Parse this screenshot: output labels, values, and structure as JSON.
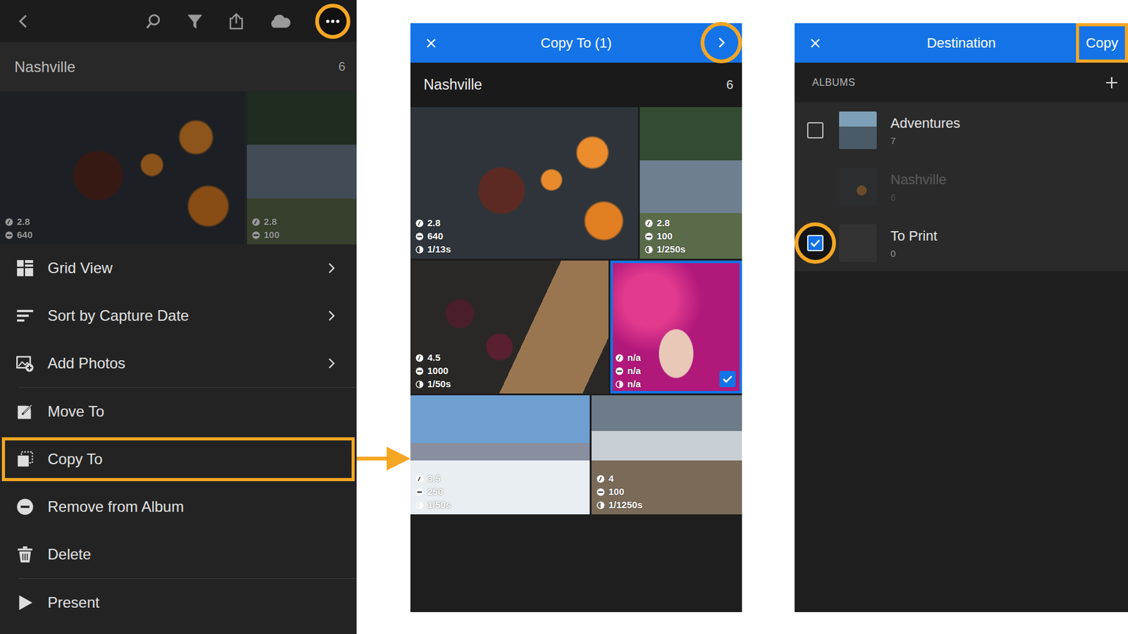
{
  "album_view": {
    "toolbar": {
      "more_highlighted": true
    },
    "title": "Nashville",
    "count": "6",
    "photos": [
      {
        "aperture": "2.8",
        "iso": "640"
      },
      {
        "aperture": "2.8",
        "iso": "100"
      }
    ],
    "menu": [
      [
        {
          "label": "Grid View",
          "has_submenu": true,
          "highlighted": false
        },
        {
          "label": "Sort by Capture Date",
          "has_submenu": true,
          "highlighted": false
        },
        {
          "label": "Add Photos",
          "has_submenu": true,
          "highlighted": false
        }
      ],
      [
        {
          "label": "Move To",
          "has_submenu": false,
          "highlighted": false
        },
        {
          "label": "Copy To",
          "has_submenu": false,
          "highlighted": true
        },
        {
          "label": "Remove from Album",
          "has_submenu": false,
          "highlighted": false
        },
        {
          "label": "Delete",
          "has_submenu": false,
          "highlighted": false
        }
      ],
      [
        {
          "label": "Present",
          "has_submenu": false,
          "highlighted": false
        }
      ]
    ]
  },
  "copy_to": {
    "title": "Copy To (1)",
    "next_highlighted": true,
    "album": "Nashville",
    "count": "6",
    "photos": [
      {
        "aperture": "2.8",
        "iso": "640",
        "shutter": "1/13s",
        "selected": false
      },
      {
        "aperture": "2.8",
        "iso": "100",
        "shutter": "1/250s",
        "selected": false
      },
      {
        "aperture": "4.5",
        "iso": "1000",
        "shutter": "1/50s",
        "selected": false
      },
      {
        "aperture": "n/a",
        "iso": "n/a",
        "shutter": "n/a",
        "selected": true
      },
      {
        "aperture": "3.5",
        "iso": "250",
        "shutter": "1/50s",
        "selected": false
      },
      {
        "aperture": "4",
        "iso": "100",
        "shutter": "1/1250s",
        "selected": false
      }
    ]
  },
  "destination": {
    "title": "Destination",
    "action": "Copy",
    "action_highlighted": true,
    "section": "ALBUMS",
    "albums": [
      {
        "name": "Adventures",
        "count": "7",
        "checked": false,
        "disabled": false,
        "highlighted": false
      },
      {
        "name": "Nashville",
        "count": "6",
        "checked": false,
        "disabled": true,
        "highlighted": false
      },
      {
        "name": "To Print",
        "count": "0",
        "checked": true,
        "disabled": false,
        "highlighted": true
      }
    ]
  }
}
